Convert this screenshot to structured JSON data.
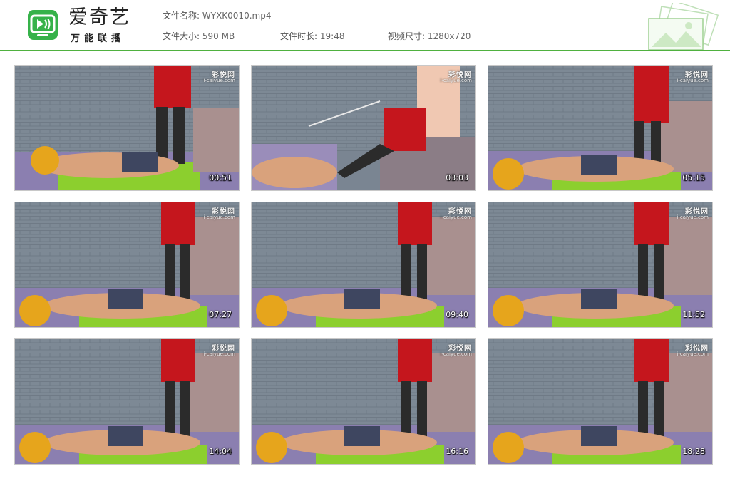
{
  "brand": {
    "name": "爱奇艺",
    "subtitle": "万能联播",
    "logo_icon": "iqiyi-tv-icon",
    "accent": "#4fb13f"
  },
  "file": {
    "name_label": "文件名称:",
    "name_value": "WYXK0010.mp4",
    "size_label": "文件大小:",
    "size_value": "590 MB",
    "duration_label": "文件时长:",
    "duration_value": "19:48",
    "dimensions_label": "视频尺寸:",
    "dimensions_value": "1280x720"
  },
  "thumbnails": [
    {
      "timestamp": "00:51"
    },
    {
      "timestamp": "03:03"
    },
    {
      "timestamp": "05:15"
    },
    {
      "timestamp": "07:27"
    },
    {
      "timestamp": "09:40"
    },
    {
      "timestamp": "11:52"
    },
    {
      "timestamp": "14:04"
    },
    {
      "timestamp": "16:16"
    },
    {
      "timestamp": "18:28"
    }
  ],
  "watermark": {
    "title": "彩悦网",
    "url": "i-caiyue.com"
  }
}
